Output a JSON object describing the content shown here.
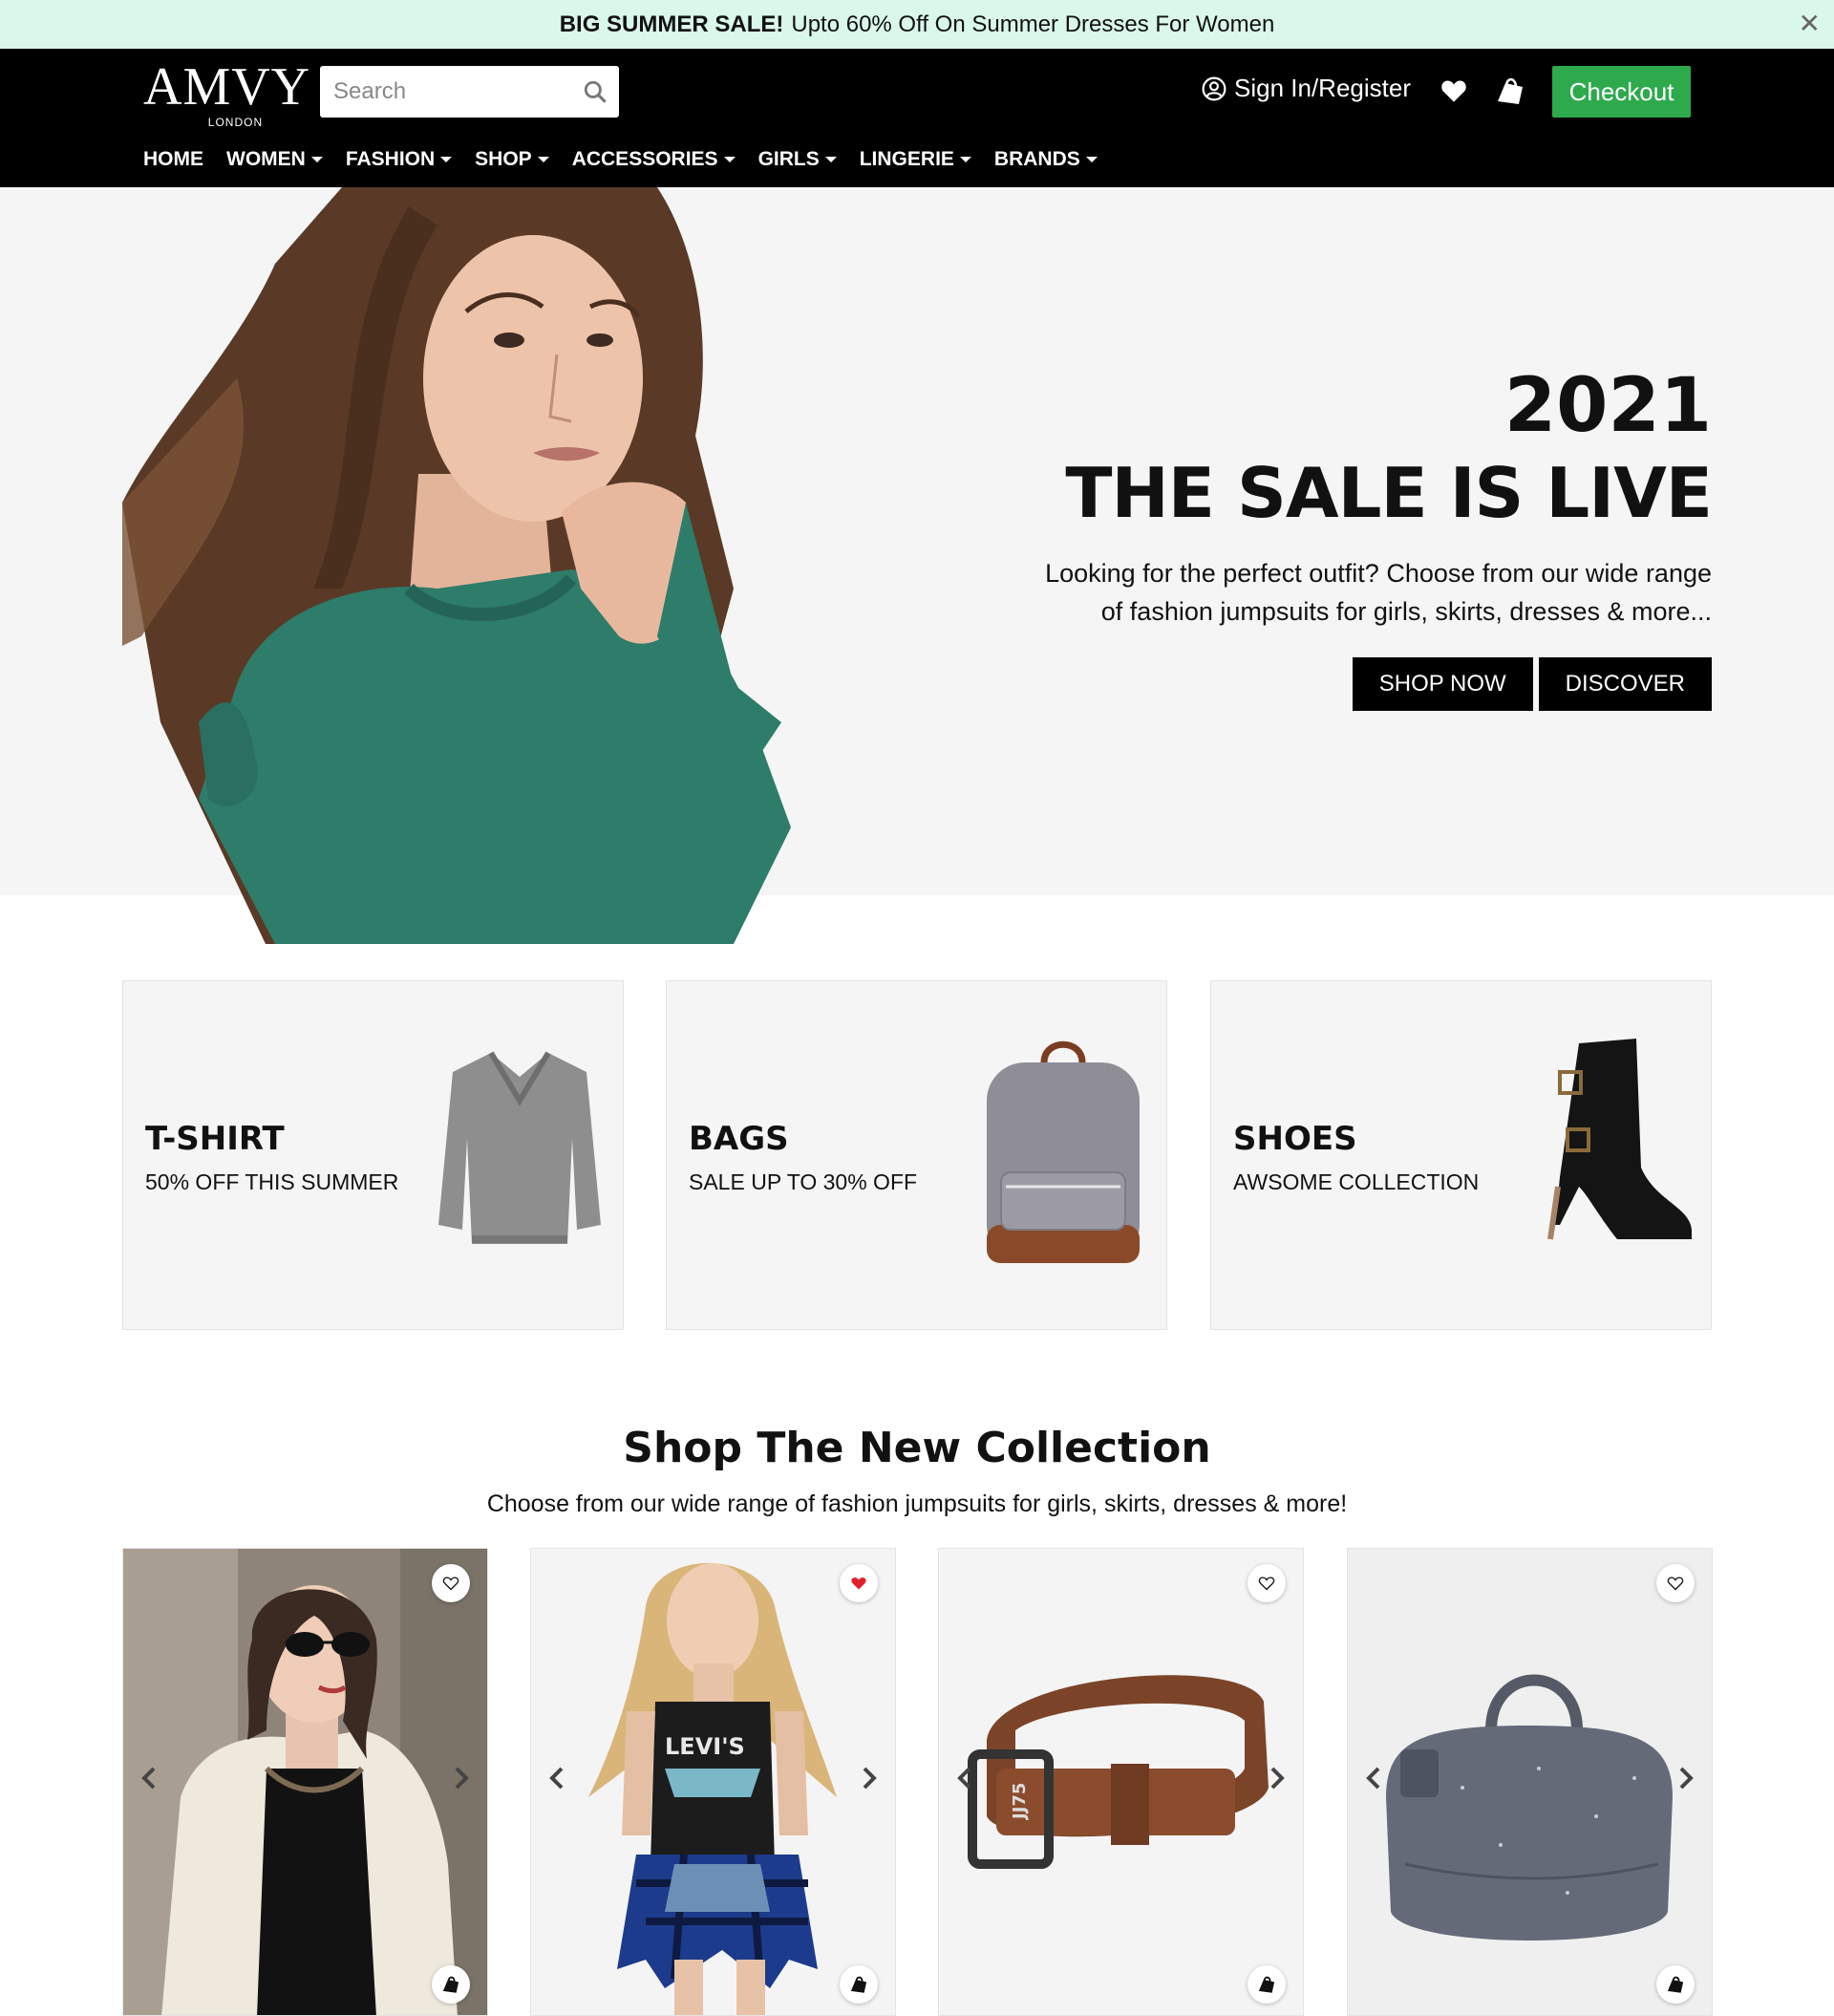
{
  "announcement": {
    "bold": "BIG SUMMER SALE!",
    "text": "Upto 60% Off On Summer Dresses For Women",
    "close": "✕"
  },
  "header": {
    "logo_word": "AMVY",
    "logo_sub": "LONDON",
    "search_placeholder": "Search",
    "signin_label": "Sign In/Register",
    "checkout_label": "Checkout"
  },
  "nav": {
    "items": [
      {
        "label": "HOME"
      },
      {
        "label": "WOMEN"
      },
      {
        "label": "FASHION"
      },
      {
        "label": "SHOP"
      },
      {
        "label": "ACCESSORIES"
      },
      {
        "label": "GIRLS"
      },
      {
        "label": "LINGERIE"
      },
      {
        "label": "BRANDS"
      }
    ]
  },
  "hero": {
    "year": "2021",
    "title": "THE SALE IS LIVE",
    "desc_line1": "Looking for the perfect outfit? Choose from our wide range",
    "desc_line2": "of fashion jumpsuits for girls, skirts, dresses & more...",
    "btn_shop": "SHOP NOW",
    "btn_discover": "DISCOVER"
  },
  "categories": [
    {
      "title": "T-SHIRT",
      "subtitle": "50% OFF THIS SUMMER"
    },
    {
      "title": "BAGS",
      "subtitle": "SALE UP TO 30% OFF"
    },
    {
      "title": "SHOES",
      "subtitle": "AWSOME COLLECTION"
    }
  ],
  "collection": {
    "title": "Shop The New Collection",
    "subtitle": "Choose from our wide range of fashion jumpsuits for girls, skirts, dresses & more!"
  },
  "colors": {
    "announce_bg": "#d9f7ea",
    "header_bg": "#000000",
    "checkout_green": "#2eaa4d",
    "fav_active": "#e0202a"
  },
  "products": [
    {
      "icon": "woman-sunglasses-photo",
      "favorited": false
    },
    {
      "icon": "woman-levis-tank-photo",
      "favorited": true
    },
    {
      "icon": "brown-belt-photo",
      "favorited": false
    },
    {
      "icon": "grey-duffel-bag-photo",
      "favorited": false
    }
  ]
}
